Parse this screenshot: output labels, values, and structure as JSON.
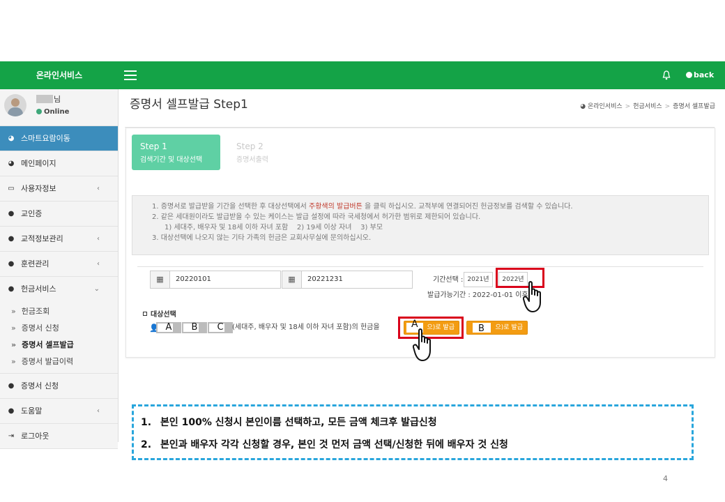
{
  "topbar": {
    "brand": "온라인서비스",
    "back_label": "back"
  },
  "user": {
    "name_suffix": "님",
    "status": "Online"
  },
  "sidebar": {
    "items": [
      {
        "label": "스마트요람이동",
        "icon": "dashboard-icon",
        "active": true
      },
      {
        "label": "메인페이지",
        "icon": "dashboard-icon"
      },
      {
        "label": "사용자정보",
        "icon": "laptop-icon",
        "chevron": "‹"
      },
      {
        "label": "교인증",
        "icon": "user-icon"
      },
      {
        "label": "교적정보관리",
        "icon": "user-icon",
        "chevron": "‹"
      },
      {
        "label": "훈련관리",
        "icon": "user-icon",
        "chevron": "‹"
      },
      {
        "label": "헌금서비스",
        "icon": "user-icon",
        "chevron": "⌄"
      }
    ],
    "subitems": [
      "헌금조회",
      "증명서 신청",
      "증명서 셀프발급",
      "증명서 발급이력"
    ],
    "items_after": [
      {
        "label": "증명서 신청",
        "icon": "user-icon"
      },
      {
        "label": "도움말",
        "icon": "user-icon",
        "chevron": "‹"
      },
      {
        "label": "로그아웃",
        "icon": "logout-icon"
      }
    ]
  },
  "page": {
    "title": "증명서 셀프발급 Step1",
    "breadcrumb": [
      "온라인서비스",
      "헌금서비스",
      "증명서 셀프발급"
    ]
  },
  "steps": {
    "step1_title": "Step 1",
    "step1_sub": "검색기간 및 대상선택",
    "step2_title": "Step 2",
    "step2_sub": "증명서출력"
  },
  "notice": {
    "line1_a": "1. 증명서로 발급받을 기간을 선택한 후 대상선택에서",
    "line1_red": "주황색의 발급버튼",
    "line1_b": "을 클릭 하십시오. 교적부에 연결되어진 헌금정보를 검색할 수 있습니다.",
    "line2": "2. 같은 세대원이라도 발급받을 수 있는 케이스는 발급 설정에 따라 국세청에서 허가한 범위로 제한되어 있습니다.",
    "line3": "1) 세대주, 배우자 및 18세 이하 자녀 포함    2) 19세 이상 자녀    3) 부모",
    "line4": "3. 대상선택에 나오지 않는 기타 가족의 헌금은 교회사무실에 문의하십시오."
  },
  "search": {
    "start_date": "20220101",
    "end_date": "20221231",
    "period_label": "기간선택 :",
    "years": [
      "2021년",
      "2022년"
    ],
    "available": "발급가능기간 : 2022-01-01 이후"
  },
  "target": {
    "title": "대상선택",
    "names": [
      "A",
      "B",
      "C"
    ],
    "desc": "(세대주, 배우자 및 18세 이하 자녀 포함)의 헌금을",
    "btn_a_label": "A",
    "btn_b_label": "B",
    "btn_suffix": "(으)로 발급",
    "btn_suffix_short": "으)로 발급"
  },
  "instructions": [
    {
      "num": "1.",
      "text": "본인 100% 신청시 본인이름 선택하고, 모든 금액 체크후 발급신청"
    },
    {
      "num": "2.",
      "text": "본인과 배우자 각각 신청할 경우, 본인 것 먼저 금액 선택/신청한 뒤에 배우자 것 신청"
    }
  ],
  "page_number": "4",
  "colors": {
    "topbar": "#14a347",
    "active_menu": "#3c8dbc",
    "step1": "#5fd0a4",
    "issue_button": "#f39c12",
    "highlight": "#d9001b",
    "instruction_border": "#29a6dc"
  }
}
